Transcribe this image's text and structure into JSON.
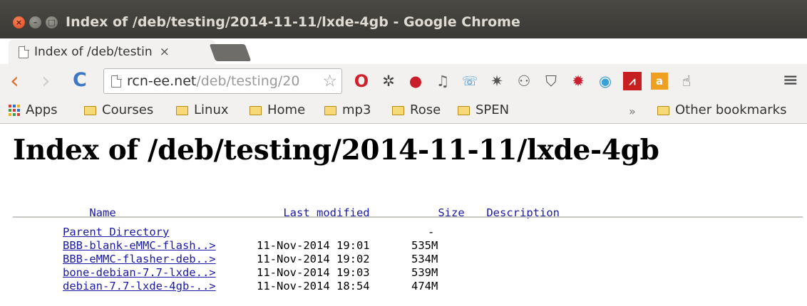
{
  "window": {
    "title": "Index of /deb/testing/2014-11-11/lxde-4gb - Google Chrome",
    "close_glyph": "×",
    "min_glyph": "–",
    "max_glyph": "□"
  },
  "tab": {
    "title": "Index of /deb/testin",
    "close_glyph": "×"
  },
  "toolbar": {
    "back_glyph": "‹",
    "forward_glyph": "›",
    "reload_glyph": "C",
    "url_host": "rcn-ee.net",
    "url_path": "/deb/testing/20",
    "star_glyph": "☆",
    "menu_glyph": "≡",
    "extensions": [
      {
        "name": "opera-icon",
        "glyph": "O"
      },
      {
        "name": "pinwheel-icon",
        "glyph": "✲"
      },
      {
        "name": "red-circle-icon",
        "glyph": "●"
      },
      {
        "name": "music-note-icon",
        "glyph": "♫"
      },
      {
        "name": "phone-icon",
        "glyph": "☏"
      },
      {
        "name": "sparkle-icon",
        "glyph": "✷"
      },
      {
        "name": "person-icon",
        "glyph": "⚇"
      },
      {
        "name": "pocket-icon",
        "glyph": "⛉"
      },
      {
        "name": "gear-icon",
        "glyph": "✹"
      },
      {
        "name": "eye-icon",
        "glyph": "◉"
      },
      {
        "name": "red-box-icon",
        "glyph": "⩘"
      },
      {
        "name": "orange-box-icon",
        "glyph": "a"
      },
      {
        "name": "hand-icon",
        "glyph": "☝"
      }
    ]
  },
  "bookmarks": {
    "items": [
      "Apps",
      "Courses",
      "Linux",
      "Home",
      "mp3",
      "Rose",
      "SPEN"
    ],
    "chevron": "»",
    "other": "Other bookmarks"
  },
  "page": {
    "heading": "Index of /deb/testing/2014-11-11/lxde-4gb",
    "columns": {
      "name": "Name",
      "last_modified": "Last modified",
      "size": "Size",
      "description": "Description"
    },
    "rows": [
      {
        "name": "Parent Directory",
        "modified": "",
        "size": "-"
      },
      {
        "name": "BBB-blank-eMMC-flash..>",
        "modified": "11-Nov-2014 19:01",
        "size": "535M"
      },
      {
        "name": "BBB-eMMC-flasher-deb..>",
        "modified": "11-Nov-2014 19:02",
        "size": "534M"
      },
      {
        "name": "bone-debian-7.7-lxde..>",
        "modified": "11-Nov-2014 19:03",
        "size": "539M"
      },
      {
        "name": "debian-7.7-lxde-4gb-..>",
        "modified": "11-Nov-2014 18:54",
        "size": "474M"
      }
    ]
  },
  "colors": {
    "link": "#1a1aa6",
    "titlebar": "#3a3935",
    "chrome": "#f2f1f0",
    "back_arrow": "#e0702a",
    "reload": "#3c78c8"
  }
}
